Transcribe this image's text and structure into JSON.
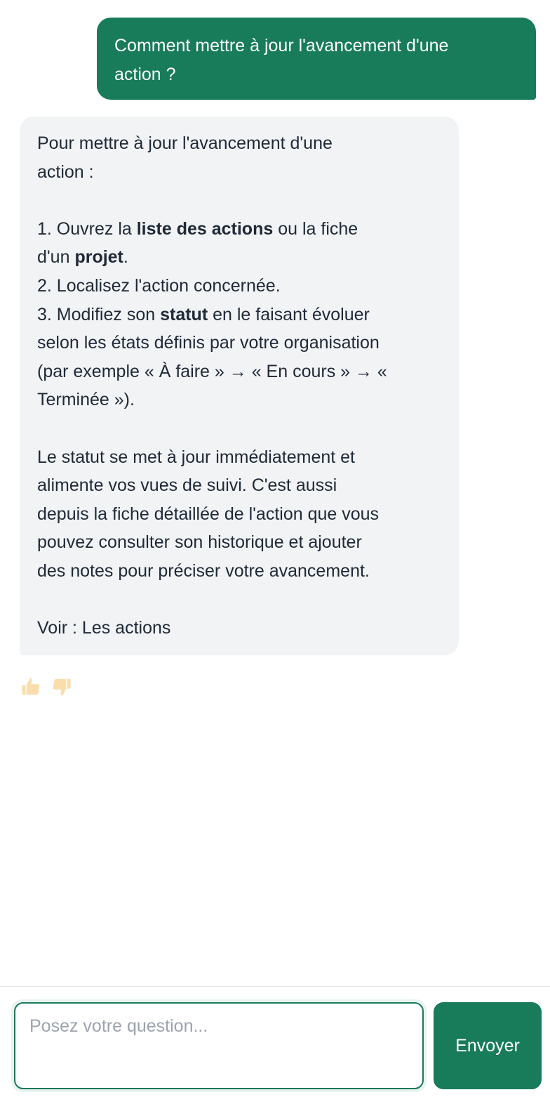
{
  "user_message": {
    "lines": [
      "Comment mettre à jour l'avancement d'une",
      "action ?"
    ]
  },
  "bot_message": {
    "intro_1": "Pour mettre à jour l'avancement d'une",
    "intro_2": "action :",
    "step1_a": "1. Ouvrez la ",
    "step1_b": "liste des actions",
    "step1_c": " ou la fiche",
    "step1_d": "d'un ",
    "step1_e": "projet",
    "step1_f": ".",
    "step2": "2. Localisez l'action concernée.",
    "step3_a": "3. Modifiez son ",
    "step3_b": "statut",
    "step3_c": " en le faisant évoluer",
    "step3_d": "selon les états définis par votre organisation",
    "step3_e": "(par exemple « À faire » → « En cours » → «",
    "step3_f": "Terminée »).",
    "para_1": "Le statut se met à jour immédiatement et",
    "para_2": "alimente vos vues de suivi. C'est aussi",
    "para_3": "depuis la fiche détaillée de l'action que vous",
    "para_4": "pouvez consulter son historique et ajouter",
    "para_5": "des notes pour préciser votre avancement.",
    "see_also": "Voir : Les actions"
  },
  "feedback": {
    "up_icon": "thumbs-up-icon",
    "down_icon": "thumbs-down-icon"
  },
  "composer": {
    "placeholder": "Posez votre question...",
    "value": "",
    "send_label": "Envoyer"
  },
  "colors": {
    "primary": "#187b5a",
    "bot_bubble": "#f1f3f5",
    "feedback_icon": "#f5c46a"
  }
}
